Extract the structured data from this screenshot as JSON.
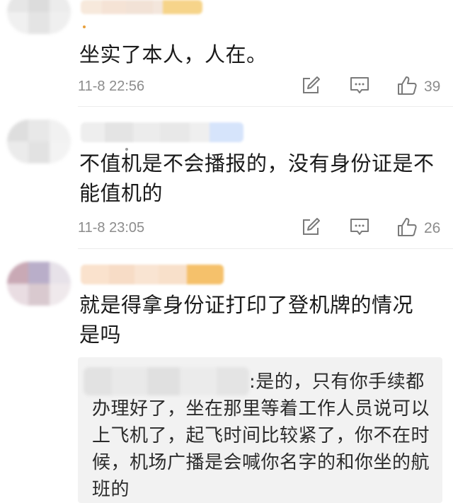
{
  "comments": [
    {
      "text": "坐实了本人，人在。",
      "timestamp": "11-8 22:56",
      "likes": "39"
    },
    {
      "text": "不值机是不会播报的，没有身份证是不能值机的",
      "timestamp": "11-8 23:05",
      "likes": "26"
    },
    {
      "text": "就是得拿身份证打印了登机牌的情况是吗"
    }
  ],
  "reply": {
    "text": ":是的，只有你手续都办理好了，坐在那里等着工作人员说可以上飞机了，起飞时间比较紧了，你不在时候，机场广播是会喊你名字的和你坐的航班的"
  },
  "icons": {
    "share": "share-edit-icon",
    "comment": "comment-icon",
    "like": "thumbs-up-icon"
  },
  "colors": {
    "text": "#1a1a1a",
    "meta": "#8c8c8c",
    "reply_bg": "#f2f2f2"
  }
}
